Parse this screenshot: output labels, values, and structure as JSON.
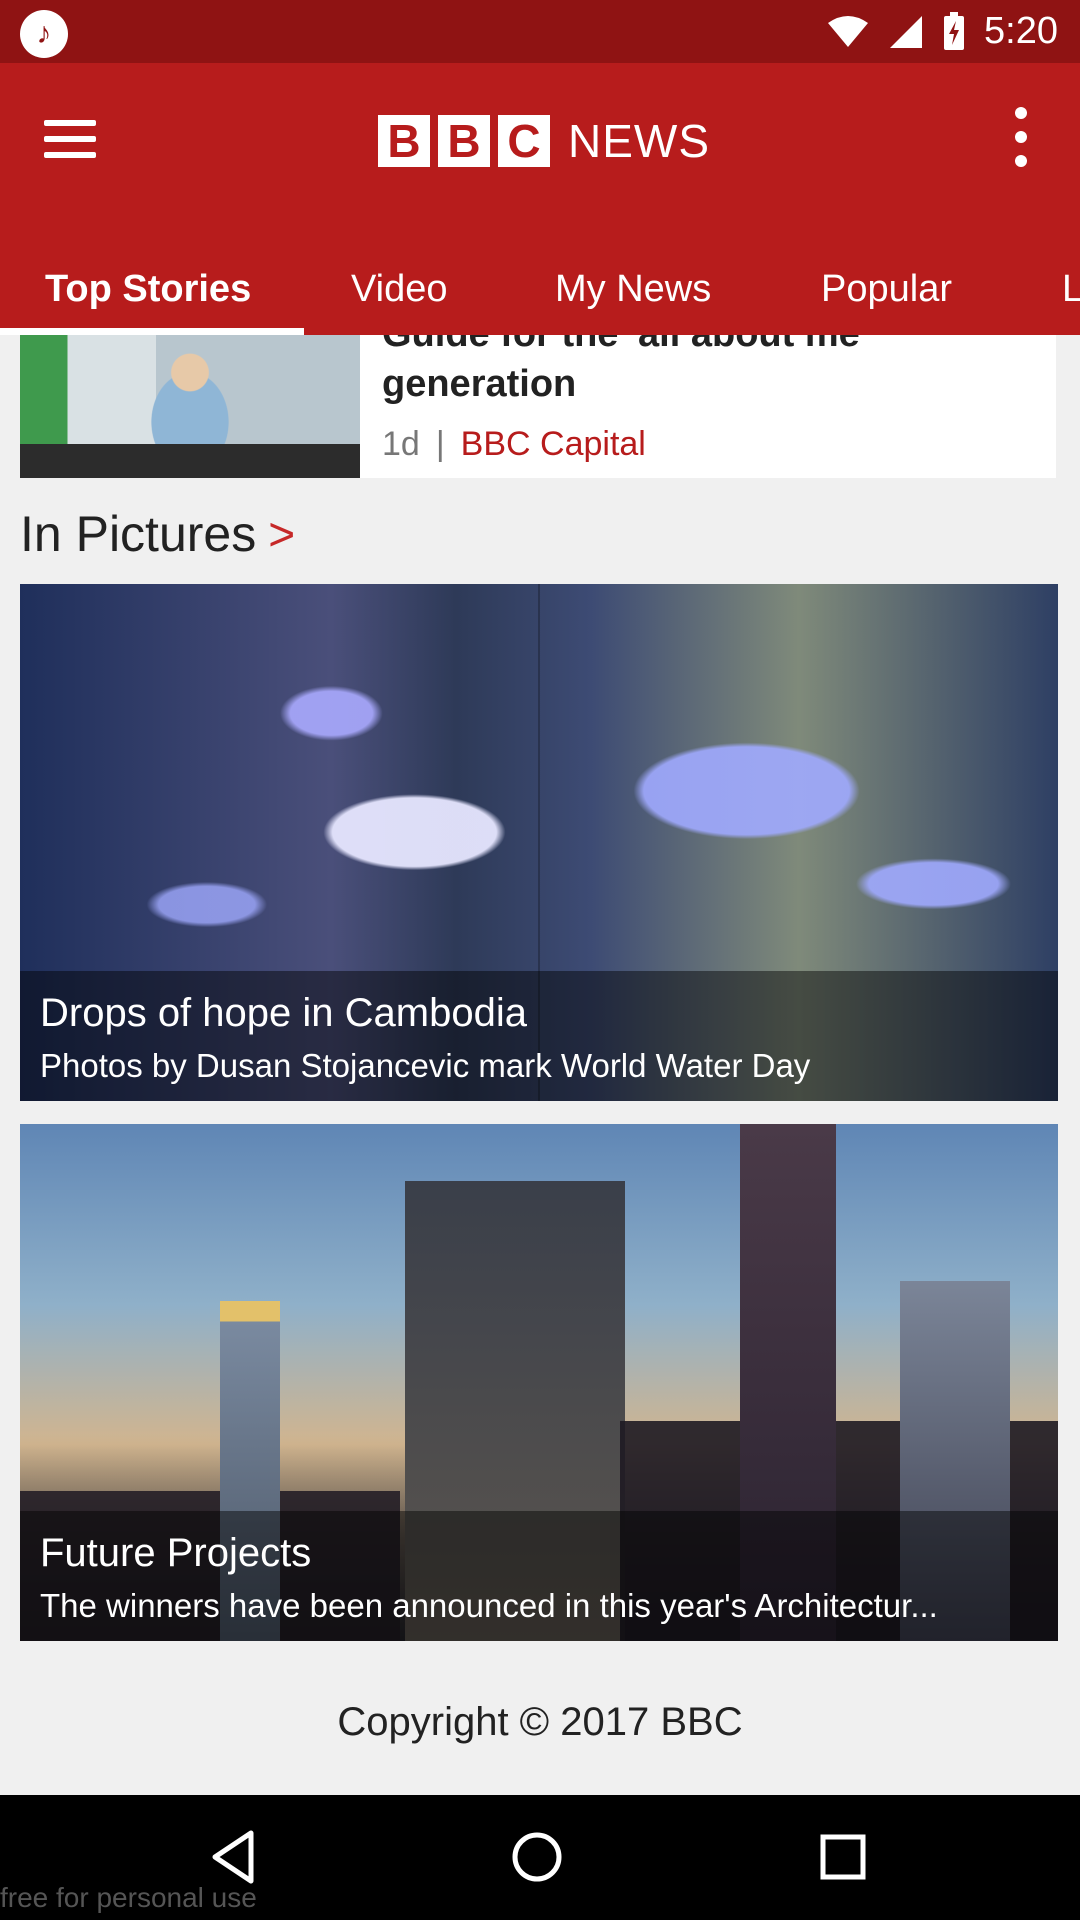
{
  "status_bar": {
    "app_icon": "music-note-icon",
    "time": "5:20",
    "icons": [
      "wifi-icon",
      "cell-signal-icon",
      "battery-charging-icon"
    ]
  },
  "app_bar": {
    "menu_icon": "hamburger-menu-icon",
    "logo": {
      "letters": [
        "B",
        "B",
        "C"
      ],
      "word": "NEWS"
    },
    "overflow_icon": "overflow-menu-icon",
    "tabs": [
      {
        "label": "Top Stories",
        "active": true
      },
      {
        "label": "Video",
        "active": false
      },
      {
        "label": "My News",
        "active": false
      },
      {
        "label": "Popular",
        "active": false
      },
      {
        "label": "L",
        "active": false
      }
    ]
  },
  "story": {
    "title": "Guide for the 'all about me' generation",
    "age": "1d",
    "separator": "|",
    "source": "BBC Capital"
  },
  "in_pictures": {
    "title": "In Pictures",
    "chevron": ">",
    "items": [
      {
        "title": "Drops of hope in Cambodia",
        "subtitle": "Photos by Dusan Stojancevic mark World Water Day"
      },
      {
        "title": "Future Projects",
        "subtitle": "The winners have been announced in this year's Architectur..."
      }
    ]
  },
  "footer": {
    "copyright": "Copyright © 2017 BBC"
  },
  "nav_bar": {
    "buttons": [
      "back-icon",
      "home-icon",
      "recents-icon"
    ]
  },
  "watermark": "free for personal use",
  "colors": {
    "brand_red": "#b71c1c",
    "status_bar": "#8f1313",
    "source_red": "#c62828"
  }
}
